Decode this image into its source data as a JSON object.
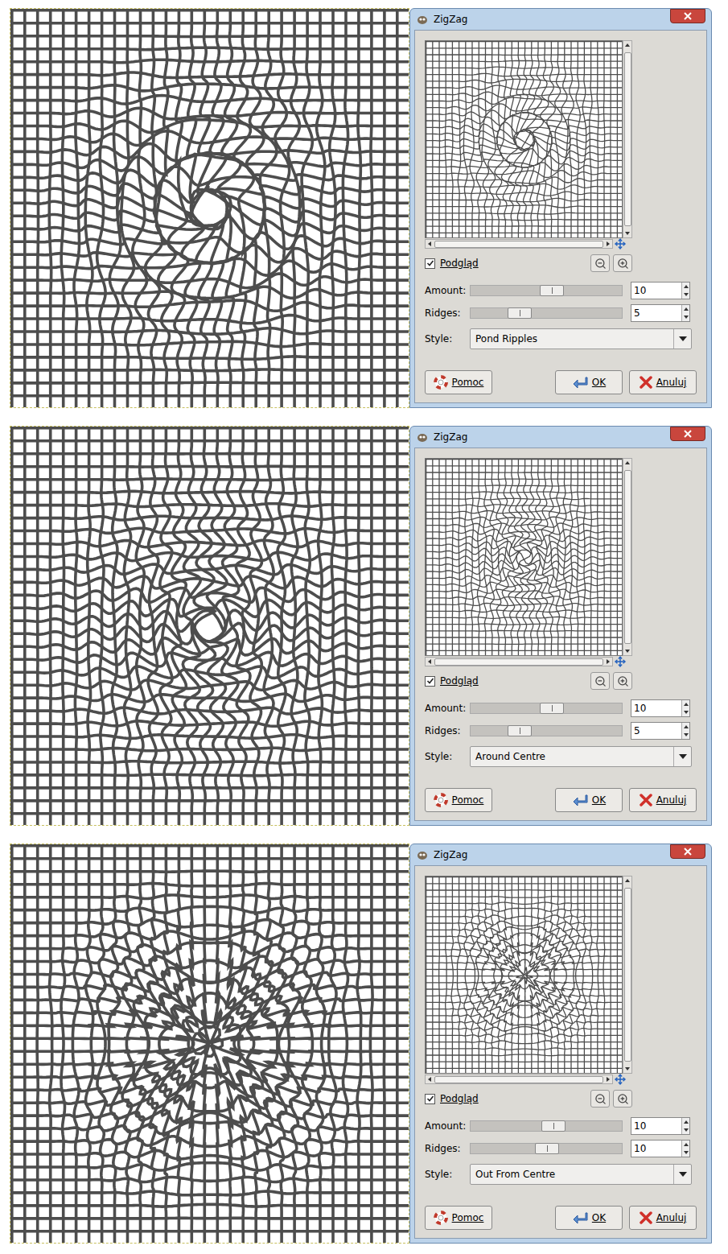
{
  "panels": [
    {
      "window": {
        "title": "ZigZag"
      },
      "preview": {
        "label": "Podgląd",
        "checked": true
      },
      "controls": [
        {
          "label": "Amount:",
          "value": "10",
          "level": 0.54
        },
        {
          "label": "Ridges:",
          "value": "5",
          "level": 0.29
        }
      ],
      "style": {
        "label": "Style:",
        "value": "Pond Ripples",
        "kind": "pond"
      },
      "buttons": [
        {
          "label": "Pomoc",
          "kind": "help"
        },
        {
          "label": "OK",
          "kind": "ok"
        },
        {
          "label": "Anuluj",
          "kind": "cancel"
        }
      ]
    },
    {
      "window": {
        "title": "ZigZag"
      },
      "preview": {
        "label": "Podgląd",
        "checked": true
      },
      "controls": [
        {
          "label": "Amount:",
          "value": "10",
          "level": 0.54
        },
        {
          "label": "Ridges:",
          "value": "5",
          "level": 0.29
        }
      ],
      "style": {
        "label": "Style:",
        "value": "Around Centre",
        "kind": "around"
      },
      "buttons": [
        {
          "label": "Pomoc",
          "kind": "help"
        },
        {
          "label": "OK",
          "kind": "ok"
        },
        {
          "label": "Anuluj",
          "kind": "cancel"
        }
      ]
    },
    {
      "window": {
        "title": "ZigZag"
      },
      "preview": {
        "label": "Podgląd",
        "checked": true
      },
      "controls": [
        {
          "label": "Amount:",
          "value": "10",
          "level": 0.55
        },
        {
          "label": "Ridges:",
          "value": "10",
          "level": 0.5
        }
      ],
      "style": {
        "label": "Style:",
        "value": "Out From Centre",
        "kind": "out"
      },
      "buttons": [
        {
          "label": "Pomoc",
          "kind": "help"
        },
        {
          "label": "OK",
          "kind": "ok"
        },
        {
          "label": "Anuluj",
          "kind": "cancel"
        }
      ]
    }
  ]
}
